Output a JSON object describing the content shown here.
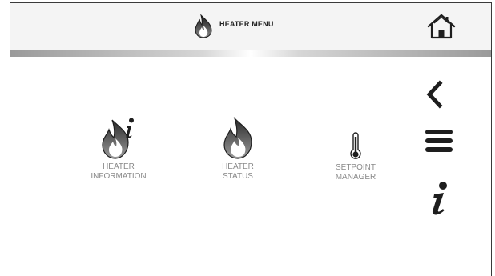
{
  "header": {
    "title": "HEATER MENU",
    "title_icon": "flame-icon",
    "home_icon": "home-icon"
  },
  "menu": {
    "items": [
      {
        "label_line1": "HEATER",
        "label_line2": "INFORMATION",
        "icon": "flame-info-icon"
      },
      {
        "label_line1": "HEATER",
        "label_line2": "STATUS",
        "icon": "flame-icon"
      },
      {
        "label_line1": "SETPOINT",
        "label_line2": "MANAGER",
        "icon": "thermometer-icon"
      }
    ]
  },
  "side_nav": {
    "back_icon": "chevron-left-icon",
    "menu_icon": "hamburger-menu-icon",
    "info_icon": "info-icon"
  },
  "colors": {
    "frame": "#3a3a3a",
    "header_bg": "#f4f4f4",
    "label_gray": "#8a8a8a",
    "icon_dark": "#1e1e1e"
  }
}
